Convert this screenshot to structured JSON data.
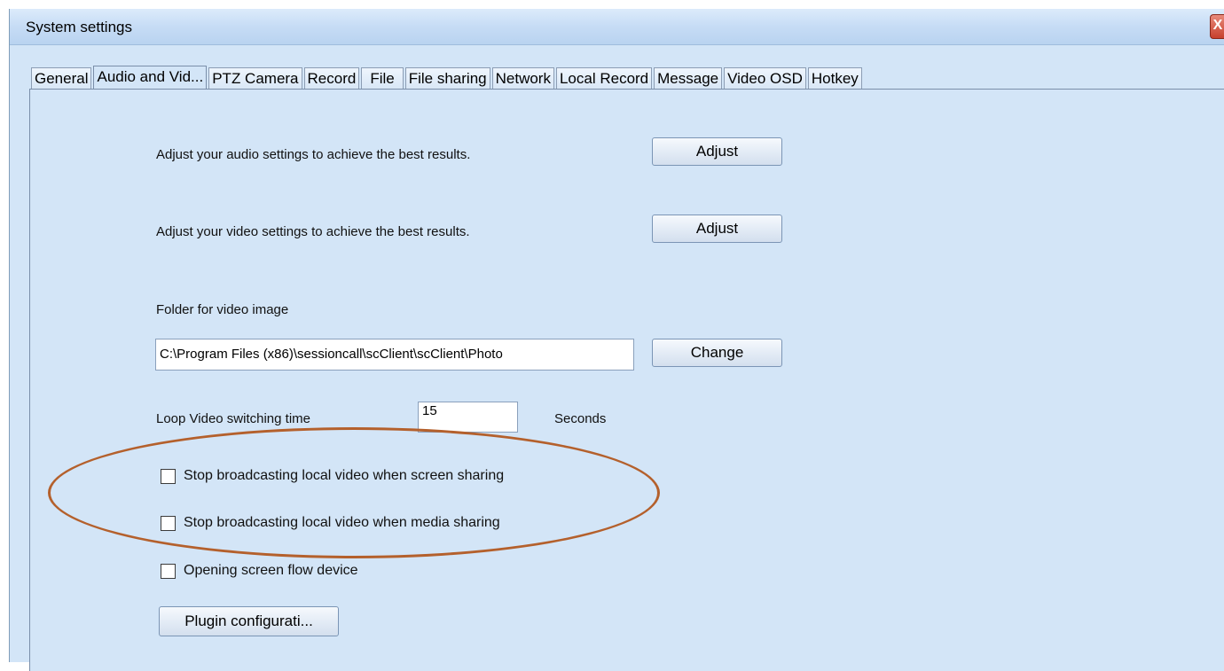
{
  "window": {
    "title": "System settings",
    "close_label": "X"
  },
  "tabs": [
    {
      "label": "General"
    },
    {
      "label": "Audio and Vid..."
    },
    {
      "label": "PTZ Camera"
    },
    {
      "label": "Record"
    },
    {
      "label": "File"
    },
    {
      "label": "File sharing"
    },
    {
      "label": "Network"
    },
    {
      "label": "Local Record"
    },
    {
      "label": "Message"
    },
    {
      "label": "Video OSD"
    },
    {
      "label": "Hotkey"
    }
  ],
  "active_tab": "Audio and Vid...",
  "audio": {
    "text": "Adjust your audio settings to achieve the best results.",
    "button": "Adjust"
  },
  "video": {
    "text": "Adjust your video settings to achieve the best results.",
    "button": "Adjust"
  },
  "folder": {
    "label": "Folder for video image",
    "path": "C:\\Program Files (x86)\\sessioncall\\scClient\\scClient\\Photo",
    "button": "Change"
  },
  "loop": {
    "label": "Loop Video switching time",
    "value": "15",
    "unit": "Seconds"
  },
  "checkboxes": [
    {
      "label": "Stop broadcasting local video when screen sharing",
      "checked": false
    },
    {
      "label": "Stop broadcasting local video when media sharing",
      "checked": false
    },
    {
      "label": "Opening screen flow device",
      "checked": false
    }
  ],
  "plugin": {
    "button": "Plugin configurati..."
  },
  "colors": {
    "panel_bg": "#d3e5f7",
    "annotation_ellipse": "#b4602c"
  }
}
